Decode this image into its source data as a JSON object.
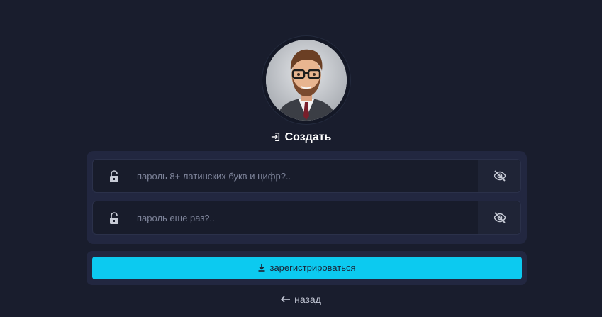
{
  "header": {
    "title": "Создать",
    "title_icon": "login-icon"
  },
  "avatar": {
    "icon": "user-avatar"
  },
  "form": {
    "password": {
      "value": "",
      "placeholder": "пароль 8+ латинских букв и цифр?..",
      "lock_icon": "unlock-icon",
      "toggle_icon": "eye-slash-icon"
    },
    "password_repeat": {
      "value": "",
      "placeholder": "пароль еще раз?..",
      "lock_icon": "unlock-icon",
      "toggle_icon": "eye-slash-icon"
    },
    "submit_label": "зарегистрироваться",
    "submit_icon": "download-icon"
  },
  "footer": {
    "back_label": "назад",
    "back_icon": "arrow-left-icon"
  },
  "colors": {
    "background": "#191d2d",
    "card": "#222740",
    "field": "#181c2b",
    "accent": "#0ccaf0"
  }
}
